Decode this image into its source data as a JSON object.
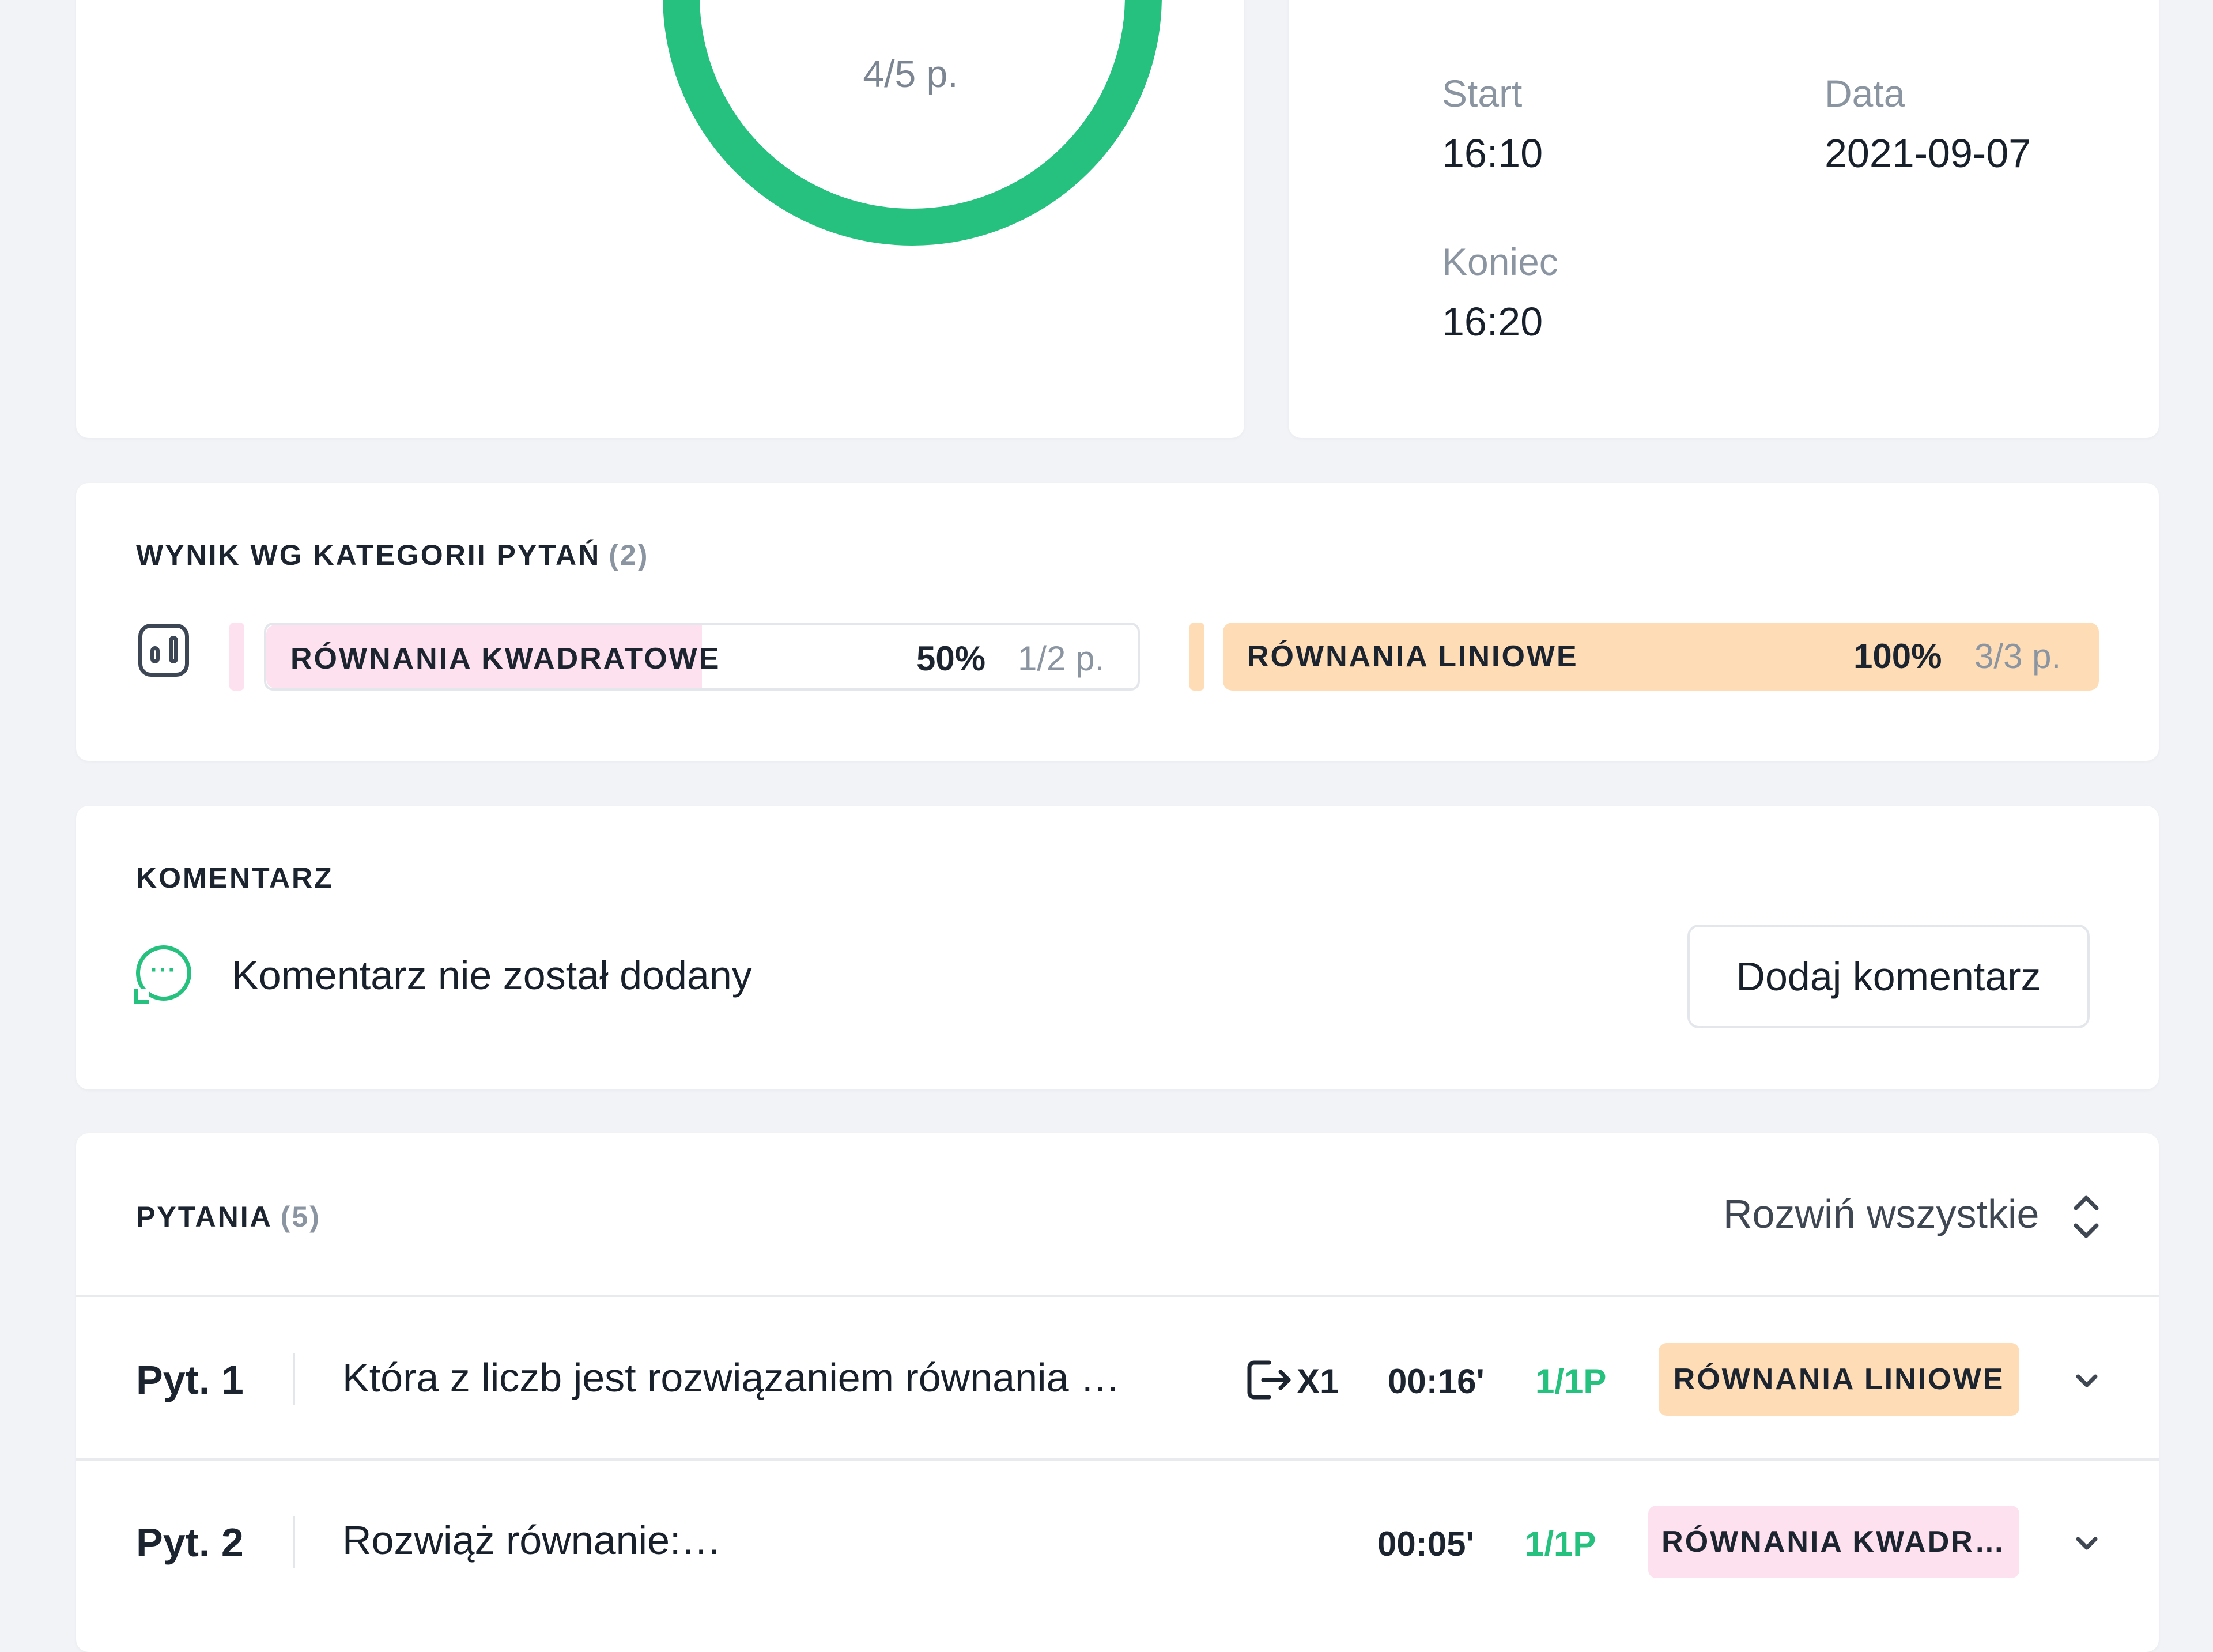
{
  "score": {
    "text": "4/5 p."
  },
  "session": {
    "start_label": "Start",
    "start_value": "16:10",
    "date_label": "Data",
    "date_value": "2021-09-07",
    "end_label": "Koniec",
    "end_value": "16:20"
  },
  "categories_section": {
    "title": "WYNIK WG KATEGORII PYTAŃ",
    "count": "(2)",
    "items": [
      {
        "name": "RÓWNANIA KWADRATOWE",
        "percent": "50%",
        "points": "1/2 p.",
        "fill": 0.5,
        "color": "#fde1ee"
      },
      {
        "name": "RÓWNANIA LINIOWE",
        "percent": "100%",
        "points": "3/3 p.",
        "fill": 1.0,
        "color": "#fddcb6"
      }
    ]
  },
  "comment_section": {
    "title": "KOMENTARZ",
    "empty_text": "Komentarz nie został dodany",
    "add_button": "Dodaj komentarz"
  },
  "questions_section": {
    "title": "PYTANIA",
    "count": "(5)",
    "expand_all": "Rozwiń wszystkie",
    "items": [
      {
        "num": "Pyt. 1",
        "text": "Która z liczb jest rozwiązaniem równania  …",
        "attempts": "X1",
        "time": "00:16'",
        "points": "1/1P",
        "category": "RÓWNANIA LINIOWE",
        "category_color": "#fddcb6"
      },
      {
        "num": "Pyt. 2",
        "text": "Rozwiąż równanie:…",
        "time": "00:05'",
        "points": "1/1P",
        "category": "RÓWNANIA KWADR…",
        "category_color": "#fde1ee"
      }
    ]
  },
  "colors": {
    "accent_green": "#26c17e",
    "muted_text": "#8b95a1"
  }
}
